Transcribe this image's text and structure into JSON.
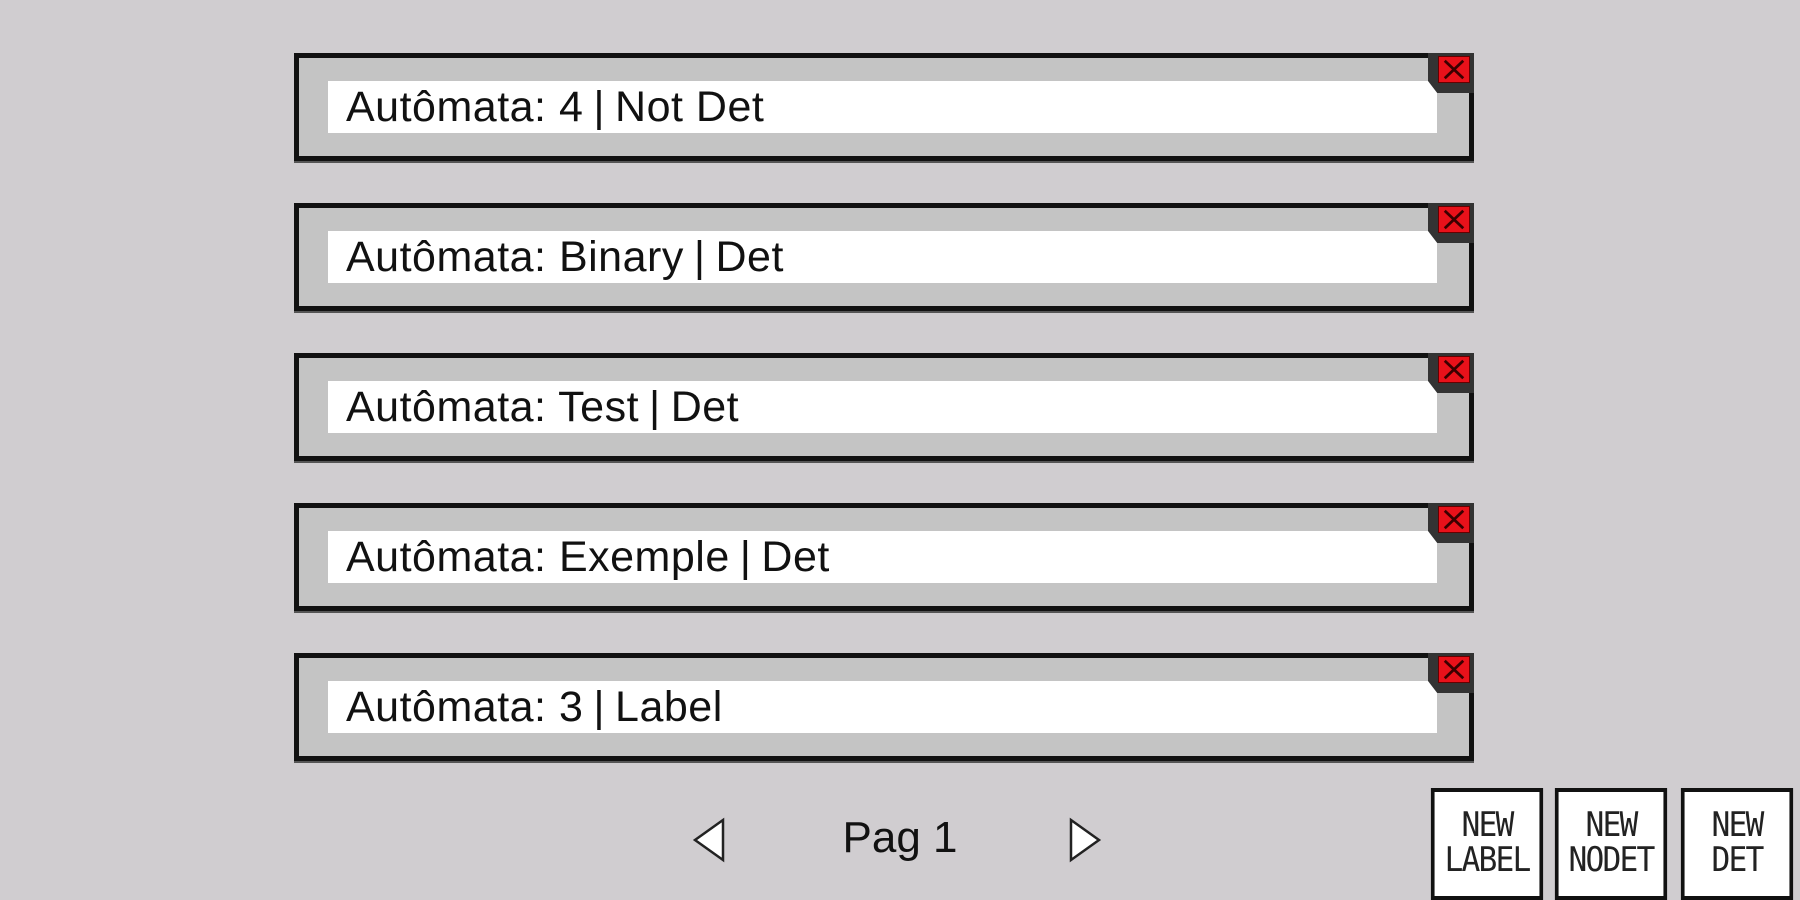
{
  "automata": [
    {
      "label": "Autômata: 4",
      "type": "Not Det"
    },
    {
      "label": "Autômata: Binary",
      "type": "Det"
    },
    {
      "label": "Autômata: Test",
      "type": "Det"
    },
    {
      "label": "Autômata: Exemple",
      "type": "Det"
    },
    {
      "label": "Autômata: 3",
      "type": "Label"
    }
  ],
  "separator": "|",
  "pager": {
    "label": "Pag 1",
    "prev_icon": "triangle-left-icon",
    "next_icon": "triangle-right-icon"
  },
  "buttons": {
    "new_label": {
      "line1": "NEW",
      "line2": "LABEL"
    },
    "new_nodet": {
      "line1": "NEW",
      "line2": "NODET"
    },
    "new_det": {
      "line1": "NEW",
      "line2": "DET"
    }
  },
  "colors": {
    "background": "#d0cdd0",
    "delete": "#e8111a",
    "panel": "#c4c4c4"
  }
}
